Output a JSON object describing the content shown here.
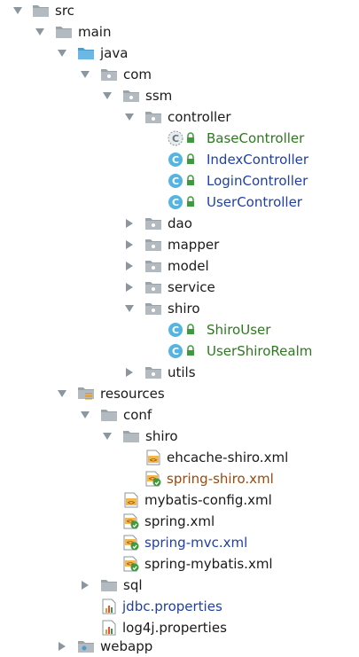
{
  "tree": {
    "rows": [
      {
        "label": "src",
        "icon": "folder-icon",
        "expanded": true
      },
      {
        "label": "main",
        "icon": "folder-icon",
        "expanded": true
      },
      {
        "label": "java",
        "icon": "source-folder-icon",
        "expanded": true
      },
      {
        "label": "com",
        "icon": "package-icon",
        "expanded": true
      },
      {
        "label": "ssm",
        "icon": "package-icon",
        "expanded": true
      },
      {
        "label": "controller",
        "icon": "package-icon",
        "expanded": true
      },
      {
        "label": "BaseController",
        "icon": "abstract-class-icon",
        "color": "#2c7a1e"
      },
      {
        "label": "IndexController",
        "icon": "class-icon",
        "color": "#1f3fa6"
      },
      {
        "label": "LoginController",
        "icon": "class-icon",
        "color": "#1f3fa6"
      },
      {
        "label": "UserController",
        "icon": "class-icon",
        "color": "#1f3fa6"
      },
      {
        "label": "dao",
        "icon": "package-icon",
        "expanded": false
      },
      {
        "label": "mapper",
        "icon": "package-icon",
        "expanded": false
      },
      {
        "label": "model",
        "icon": "package-icon",
        "expanded": false
      },
      {
        "label": "service",
        "icon": "package-icon",
        "expanded": false
      },
      {
        "label": "shiro",
        "icon": "package-icon",
        "expanded": true
      },
      {
        "label": "ShiroUser",
        "icon": "class-icon",
        "color": "#2c7a1e"
      },
      {
        "label": "UserShiroRealm",
        "icon": "class-icon",
        "color": "#2c7a1e"
      },
      {
        "label": "utils",
        "icon": "package-icon",
        "expanded": false
      },
      {
        "label": "resources",
        "icon": "resources-folder-icon",
        "expanded": true
      },
      {
        "label": "conf",
        "icon": "folder-icon",
        "expanded": true
      },
      {
        "label": "shiro",
        "icon": "folder-icon",
        "expanded": true
      },
      {
        "label": "ehcache-shiro.xml",
        "icon": "xml-file-icon"
      },
      {
        "label": "spring-shiro.xml",
        "icon": "spring-xml-file-icon",
        "color": "#9a4a0c"
      },
      {
        "label": "mybatis-config.xml",
        "icon": "xml-file-icon"
      },
      {
        "label": "spring.xml",
        "icon": "spring-xml-file-icon"
      },
      {
        "label": "spring-mvc.xml",
        "icon": "spring-xml-file-icon",
        "color": "#1f3fa6"
      },
      {
        "label": "spring-mybatis.xml",
        "icon": "spring-xml-file-icon"
      },
      {
        "label": "sql",
        "icon": "folder-icon",
        "expanded": false
      },
      {
        "label": "jdbc.properties",
        "icon": "properties-file-icon",
        "color": "#1f3fa6"
      },
      {
        "label": "log4j.properties",
        "icon": "properties-file-icon"
      },
      {
        "label": "webapp",
        "icon": "web-folder-icon",
        "expanded": false
      }
    ]
  },
  "colors": {
    "folder": "#8c969e",
    "source_folder": "#5ba8d6",
    "class_circle": "#55b5e0",
    "lock_green": "#3d9a3d",
    "green_text": "#2c7a1e",
    "blue_text": "#1f3fa6",
    "brown_text": "#9a4a0c"
  }
}
